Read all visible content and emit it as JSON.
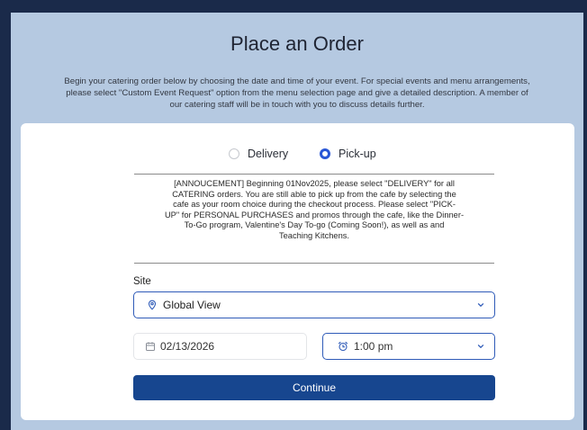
{
  "header": {
    "title": "Place an Order",
    "intro_lines": [
      "Begin your catering order below by choosing the date and time of your event. For special events and menu arrangements,",
      "please select \"Custom Event Request\" option from the menu selection page and give a detailed description. A member of",
      "our catering staff will be in touch with you to discuss details further."
    ]
  },
  "order_type": {
    "options": [
      {
        "label": "Delivery",
        "selected": false
      },
      {
        "label": "Pick-up",
        "selected": true
      }
    ]
  },
  "announcement": {
    "lines": [
      "[ANNOUCEMENT] Beginning 01Nov2025, please select \"DELIVERY\" for all",
      "CATERING orders. You are still able to pick up from the cafe by selecting the",
      "cafe as your room choice during the checkout process. Please select \"PICK-",
      "UP\" for PERSONAL PURCHASES and promos through the cafe, like the Dinner-",
      "To-Go program, Valentine's Day To-go (Coming Soon!), as well as and",
      "Teaching Kitchens."
    ]
  },
  "form": {
    "site_label": "Site",
    "site_value": "Global View",
    "date_value": "02/13/2026",
    "time_value": "1:00 pm",
    "continue_label": "Continue"
  },
  "colors": {
    "accent": "#2956d6",
    "button": "#17468f",
    "header_bg": "#b5c9e1"
  },
  "icons": [
    "location-pin-icon",
    "chevron-down-icon",
    "calendar-icon",
    "alarm-clock-icon"
  ]
}
